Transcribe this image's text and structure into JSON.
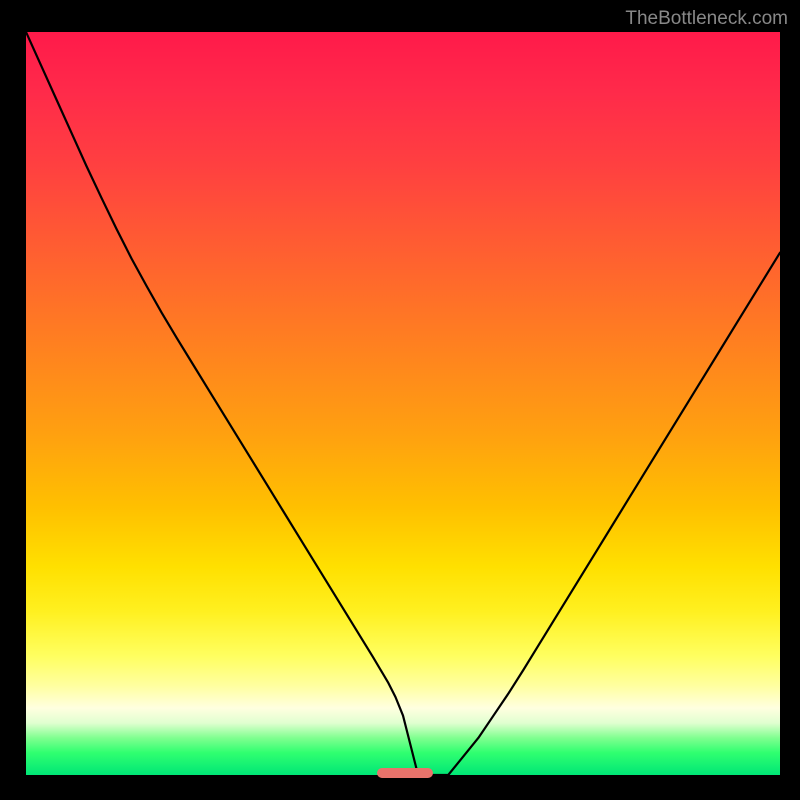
{
  "watermark": {
    "label": "TheBottleneck.com"
  },
  "colors": {
    "black": "#000000",
    "watermark_text": "#888888",
    "curve_stroke": "#000000",
    "marker_fill": "#e8736b",
    "gradient_top": "#ff1a4a",
    "gradient_bottom": "#00e676"
  },
  "chart_data": {
    "type": "line",
    "title": "",
    "xlabel": "",
    "ylabel": "",
    "xlim": [
      0,
      100
    ],
    "ylim": [
      0,
      100
    ],
    "x": [
      0,
      2,
      4,
      6,
      8,
      10,
      12,
      14,
      16,
      18,
      20,
      22,
      24,
      26,
      28,
      30,
      32,
      34,
      36,
      38,
      40,
      42,
      44,
      46,
      48,
      49,
      50,
      51,
      52,
      54,
      56,
      58,
      60,
      62,
      64,
      66,
      68,
      70,
      72,
      74,
      76,
      78,
      80,
      82,
      84,
      86,
      88,
      90,
      92,
      94,
      96,
      98,
      100
    ],
    "y": [
      100,
      95.5,
      91,
      86.5,
      82,
      77.7,
      73.5,
      69.5,
      65.8,
      62.2,
      58.8,
      55.5,
      52.2,
      48.9,
      45.6,
      42.3,
      39,
      35.7,
      32.4,
      29.1,
      25.8,
      22.5,
      19.2,
      15.9,
      12.5,
      10.5,
      8,
      4,
      0,
      0,
      0,
      2.5,
      5,
      8,
      11,
      14.2,
      17.5,
      20.8,
      24.1,
      27.4,
      30.7,
      34,
      37.3,
      40.6,
      43.9,
      47.2,
      50.5,
      53.8,
      57.1,
      60.4,
      63.7,
      67,
      70.3
    ],
    "optimum": {
      "x_start": 46.5,
      "x_end": 54,
      "y": 0.3,
      "marker_height": 1.4
    },
    "grid": false,
    "legend": false
  }
}
